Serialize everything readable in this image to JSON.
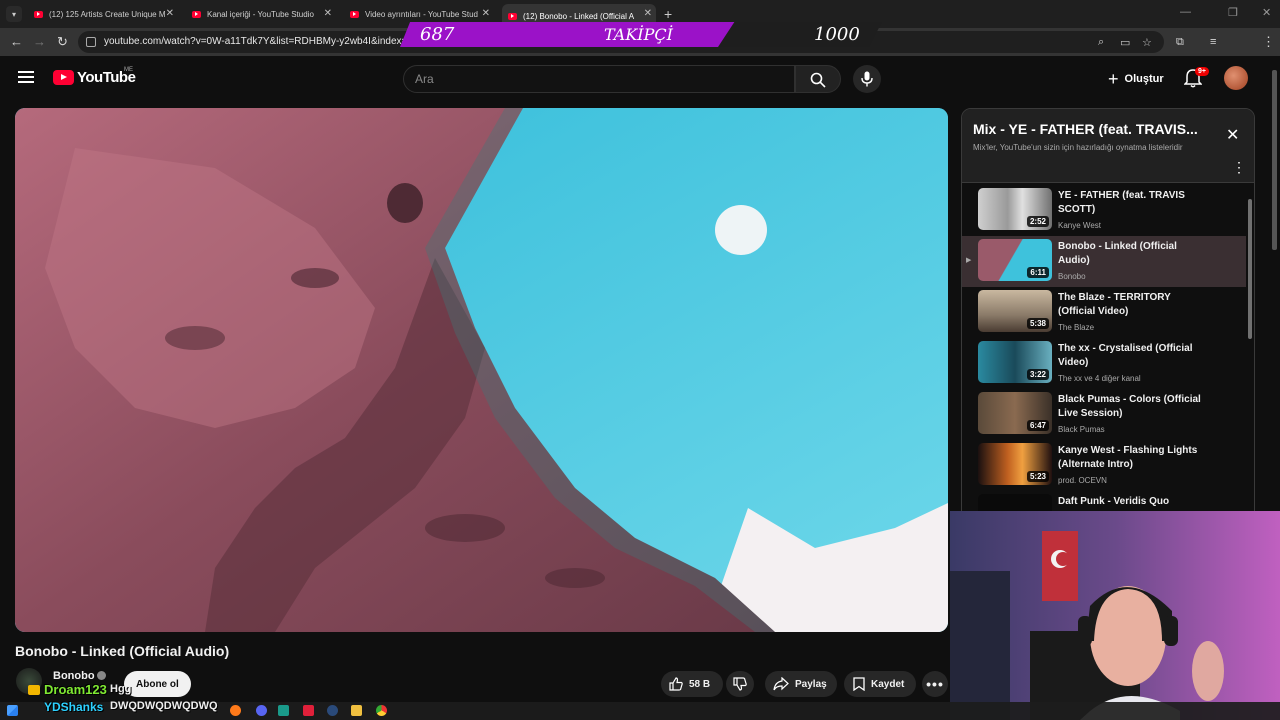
{
  "browser": {
    "tabs": [
      {
        "title": "(12) 125 Artists Create Unique M",
        "active": false
      },
      {
        "title": "Kanal içeriği - YouTube Studio",
        "active": false
      },
      {
        "title": "Video ayrıntıları - YouTube Stud",
        "active": false
      },
      {
        "title": "(12) Bonobo - Linked (Official A",
        "active": true
      }
    ],
    "url": "youtube.com/watch?v=0W-a11Tdk7Y&list=RDHBMy-y2wb4I&index=2"
  },
  "overlay": {
    "follower_count": "687",
    "follower_label": "TAKİPÇİ",
    "follower_goal": "1000"
  },
  "header": {
    "logo_text": "YouTube",
    "region": "ME",
    "search_placeholder": "Ara",
    "create_label": "Oluştur",
    "notification_badge": "9+"
  },
  "video": {
    "title": "Bonobo - Linked (Official Audio)",
    "channel": "Bonobo",
    "subscribe_label": "Abone ol",
    "like_count": "58 B",
    "share_label": "Paylaş",
    "save_label": "Kaydet"
  },
  "playlist": {
    "title": "Mix - YE - FATHER (feat. TRAVIS...",
    "subtitle": "Mix'ler, YouTube'un sizin için hazırladığı oynatma listeleridir",
    "items": [
      {
        "title": "YE - FATHER (feat. TRAVIS SCOTT)",
        "channel": "Kanye West",
        "duration": "2:52",
        "current": false
      },
      {
        "title": "Bonobo - Linked (Official Audio)",
        "channel": "Bonobo",
        "duration": "6:11",
        "current": true
      },
      {
        "title": "The Blaze - TERRITORY (Official Video)",
        "channel": "The Blaze",
        "duration": "5:38",
        "current": false
      },
      {
        "title": "The xx - Crystalised (Official Video)",
        "channel": "The xx ve 4 diğer kanal",
        "duration": "3:22",
        "current": false
      },
      {
        "title": "Black Pumas - Colors (Official Live Session)",
        "channel": "Black Pumas",
        "duration": "6:47",
        "current": false
      },
      {
        "title": "Kanye West - Flashing Lights (Alternate Intro)",
        "channel": "prod. OCEVN",
        "duration": "5:23",
        "current": false
      },
      {
        "title": "Daft Punk - Veridis Quo",
        "channel": "",
        "duration": "",
        "current": false
      }
    ]
  },
  "chat": {
    "user1": "Droam123",
    "msg1": "Hgg",
    "user2": "YDShanks",
    "msg2": "DWQDWQDWQDWQ"
  },
  "colors": {
    "accent": "#ff0033",
    "banner_purple": "#9b12c8",
    "chat_green": "#7fe832",
    "chat_blue": "#2ed1ff"
  }
}
